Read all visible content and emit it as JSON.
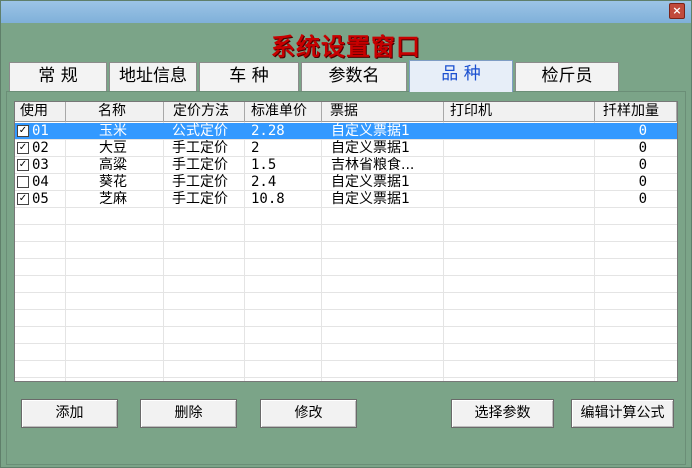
{
  "window": {
    "close_glyph": "×"
  },
  "app_title": "系统设置窗口",
  "tabs": [
    {
      "label": "常 规"
    },
    {
      "label": "地址信息"
    },
    {
      "label": "车 种"
    },
    {
      "label": "参数名"
    },
    {
      "label": "品 种",
      "active": true
    },
    {
      "label": "检斤员"
    }
  ],
  "grid": {
    "columns": [
      "使用",
      "名称",
      "定价方法",
      "标准单价",
      "票据",
      "打印机",
      "扦样加量"
    ],
    "rows": [
      {
        "checked": true,
        "code": "01",
        "name": "玉米",
        "pricing": "公式定价",
        "price": "2.28",
        "receipt": "自定义票据1",
        "printer": "",
        "sample_add": "0",
        "selected": true
      },
      {
        "checked": true,
        "code": "02",
        "name": "大豆",
        "pricing": "手工定价",
        "price": "2",
        "receipt": "自定义票据1",
        "printer": "",
        "sample_add": "0"
      },
      {
        "checked": true,
        "code": "03",
        "name": "高粱",
        "pricing": "手工定价",
        "price": "1.5",
        "receipt": "吉林省粮食...",
        "printer": "",
        "sample_add": "0"
      },
      {
        "checked": false,
        "code": "04",
        "name": "葵花",
        "pricing": "手工定价",
        "price": "2.4",
        "receipt": "自定义票据1",
        "printer": "",
        "sample_add": "0"
      },
      {
        "checked": true,
        "code": "05",
        "name": "芝麻",
        "pricing": "手工定价",
        "price": "10.8",
        "receipt": "自定义票据1",
        "printer": "",
        "sample_add": "0"
      }
    ]
  },
  "buttons": {
    "add": "添加",
    "delete": "删除",
    "modify": "修改",
    "select_params": "选择参数",
    "edit_formula": "编辑计算公式"
  },
  "colors": {
    "background": "#7ba488",
    "title": "#c80000",
    "selected_row": "#3399ff",
    "active_tab_text": "#1a4fd0"
  },
  "icons": {
    "check": "✓"
  }
}
